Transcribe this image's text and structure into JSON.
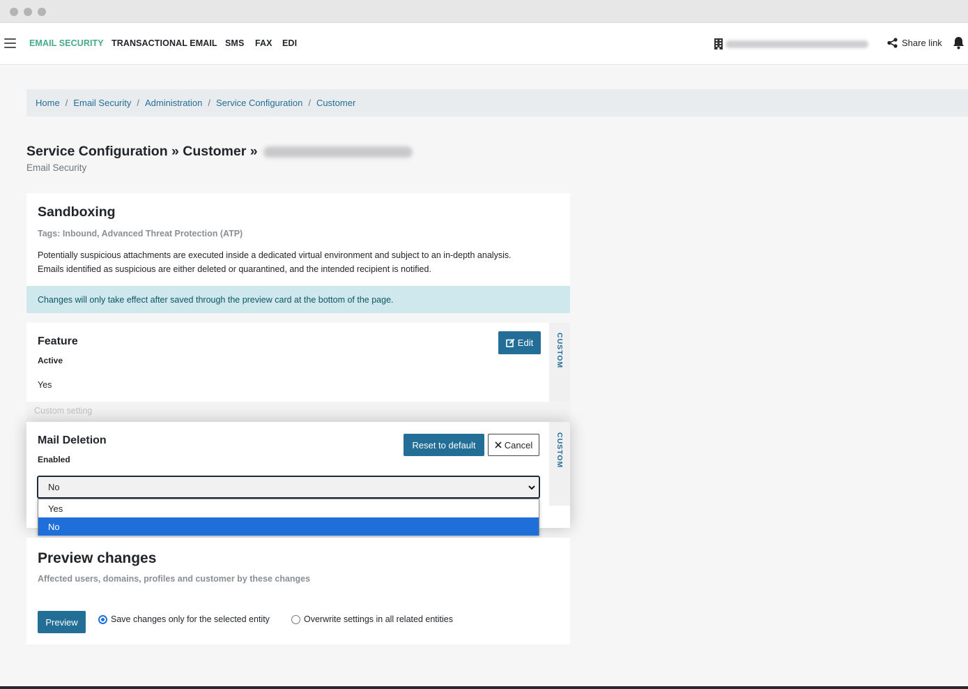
{
  "nav": {
    "items": [
      "EMAIL SECURITY",
      "TRANSACTIONAL EMAIL",
      "SMS",
      "FAX",
      "EDI"
    ],
    "share_label": "Share link"
  },
  "breadcrumb": [
    "Home",
    "Email Security",
    "Administration",
    "Service Configuration",
    "Customer"
  ],
  "page": {
    "title": "Service Configuration » Customer »",
    "subtitle": "Email Security"
  },
  "intro": {
    "heading": "Sandboxing",
    "tags": "Tags: Inbound, Advanced Threat Protection (ATP)",
    "desc_line1": "Potentially suspicious attachments are executed inside a dedicated virtual environment and subject to an in-depth analysis.",
    "desc_line2": "Emails identified as suspicious are either deleted or quarantined, and the intended recipient is notified."
  },
  "info_note": "Changes will only take effect after saved through the preview card at the bottom of the page.",
  "feature": {
    "heading": "Feature",
    "label": "Active",
    "value": "Yes",
    "edit_label": "Edit",
    "side_label": "CUSTOM"
  },
  "custom_setting_label": "Custom setting",
  "mail_deletion": {
    "heading": "Mail Deletion",
    "label": "Enabled",
    "selected": "No",
    "options": [
      "Yes",
      "No"
    ],
    "reset_label": "Reset to default",
    "cancel_label": "Cancel",
    "side_label": "CUSTOM"
  },
  "preview": {
    "heading": "Preview changes",
    "sub": "Affected users, domains, profiles and customer by these changes",
    "button": "Preview",
    "radio_save": "Save changes only for the selected entity",
    "radio_overwrite": "Overwrite settings in all related entities"
  },
  "colors": {
    "accent_green": "#46a98a",
    "primary_blue": "#236e96",
    "selected_option": "#1e6fd9",
    "info_bg": "#cfe8ee"
  }
}
